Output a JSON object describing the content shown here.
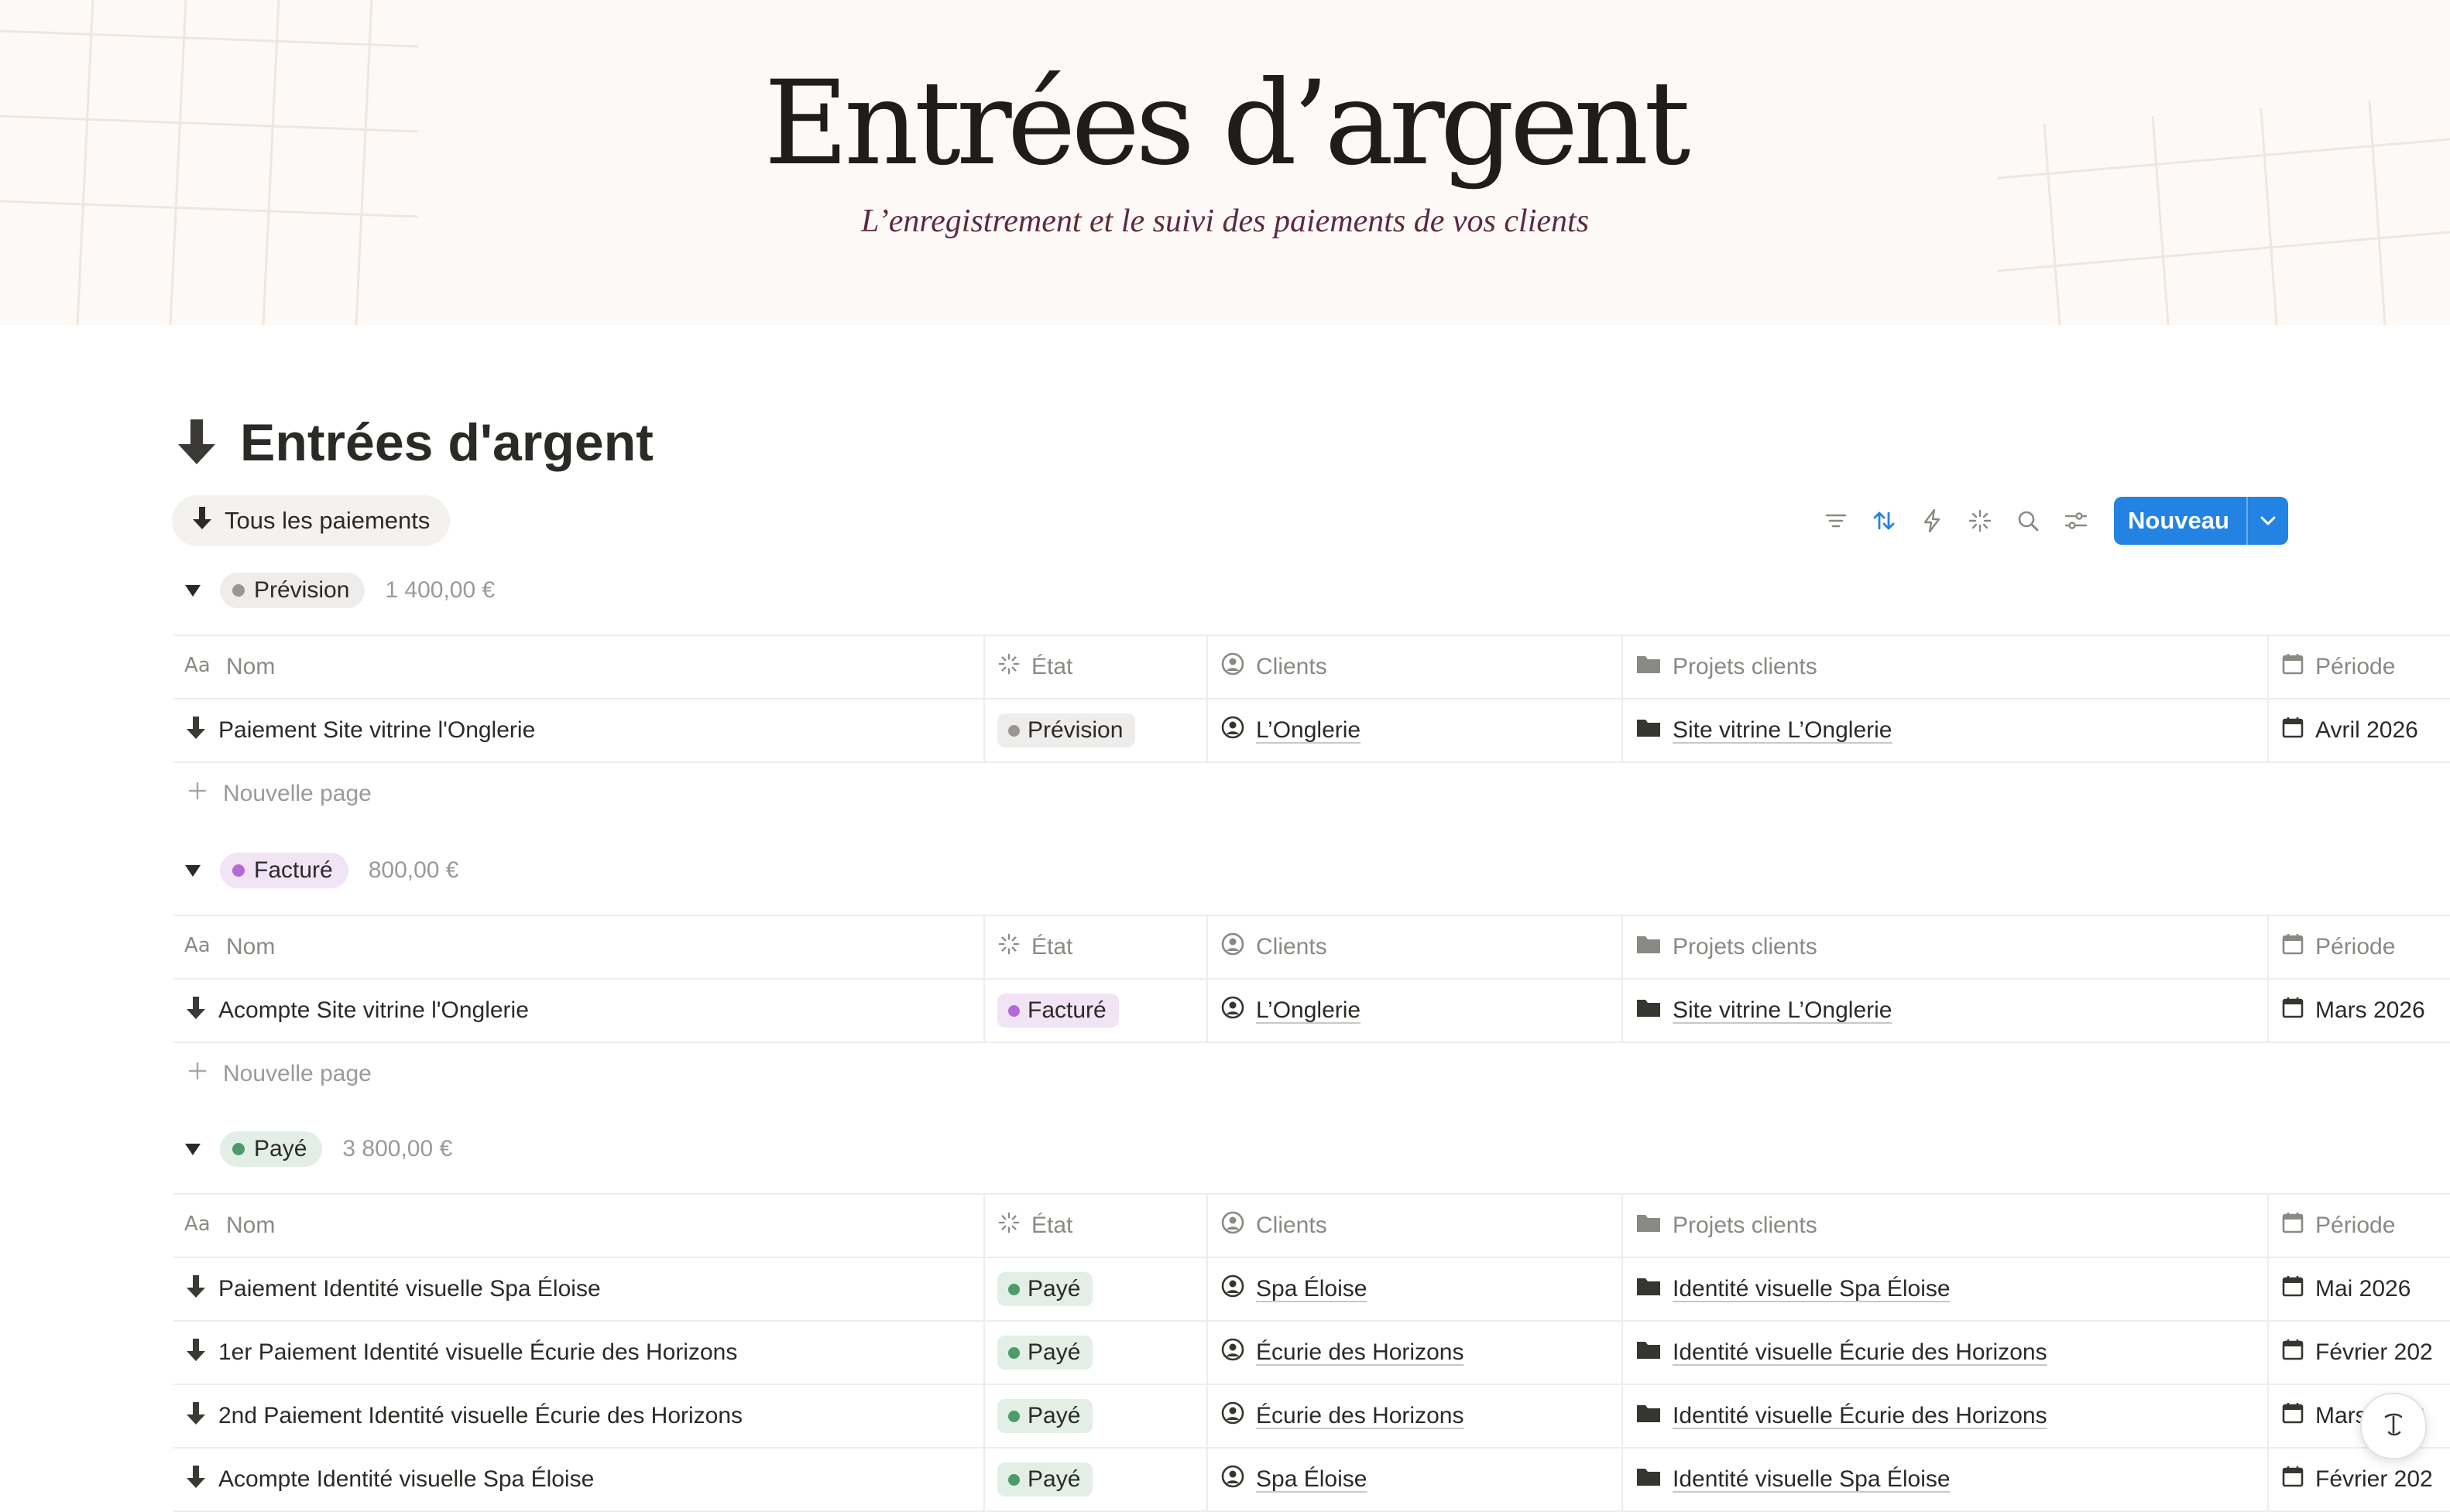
{
  "banner": {
    "title": "Entrées d’argent",
    "subtitle": "L’enregistrement et le suivi des paiements de vos clients"
  },
  "page": {
    "title": "Entrées d'argent",
    "icon": "arrow-down-icon"
  },
  "view": {
    "label": "Tous les paiements",
    "icon": "arrow-down-icon"
  },
  "toolbar": {
    "icons": [
      "filter-icon",
      "sort-icon",
      "automation-bolt-icon",
      "loading-sparkle-icon",
      "search-icon",
      "settings-sliders-icon"
    ],
    "new_label": "Nouveau",
    "accent": "#2383e2"
  },
  "columns": {
    "name": "Nom",
    "state": "État",
    "clients": "Clients",
    "projects": "Projets clients",
    "period": "Période"
  },
  "new_page_label": "Nouvelle page",
  "colors": {
    "prevision_bg": "#efedeb",
    "prevision_dot": "#9b9692",
    "facture_bg": "#f1e4f5",
    "facture_dot": "#b46ad6",
    "paye_bg": "#e3efe6",
    "paye_dot": "#4d9b6a"
  },
  "groups": [
    {
      "label": "Prévision",
      "total": "1 400,00 €",
      "rows": [
        {
          "name": "Paiement Site vitrine l'Onglerie",
          "state": "Prévision",
          "client": "L’Onglerie",
          "project": "Site vitrine L’Onglerie",
          "period": "Avril 2026"
        }
      ]
    },
    {
      "label": "Facturé",
      "total": "800,00 €",
      "rows": [
        {
          "name": "Acompte Site vitrine l'Onglerie",
          "state": "Facturé",
          "client": "L’Onglerie",
          "project": "Site vitrine L’Onglerie",
          "period": "Mars 2026"
        }
      ]
    },
    {
      "label": "Payé",
      "total": "3 800,00 €",
      "rows": [
        {
          "name": "Paiement Identité visuelle Spa Éloise",
          "state": "Payé",
          "client": "Spa Éloise",
          "project": "Identité visuelle Spa Éloise",
          "period": "Mai 2026"
        },
        {
          "name": "1er Paiement Identité visuelle Écurie des Horizons",
          "state": "Payé",
          "client": "Écurie des Horizons",
          "project": "Identité visuelle Écurie des Horizons",
          "period": "Février 202"
        },
        {
          "name": "2nd Paiement Identité visuelle Écurie des Horizons",
          "state": "Payé",
          "client": "Écurie des Horizons",
          "project": "Identité visuelle Écurie des Horizons",
          "period": "Mars 2026"
        },
        {
          "name": "Acompte Identité visuelle Spa Éloise",
          "state": "Payé",
          "client": "Spa Éloise",
          "project": "Identité visuelle Spa Éloise",
          "period": "Février 202"
        }
      ]
    }
  ]
}
